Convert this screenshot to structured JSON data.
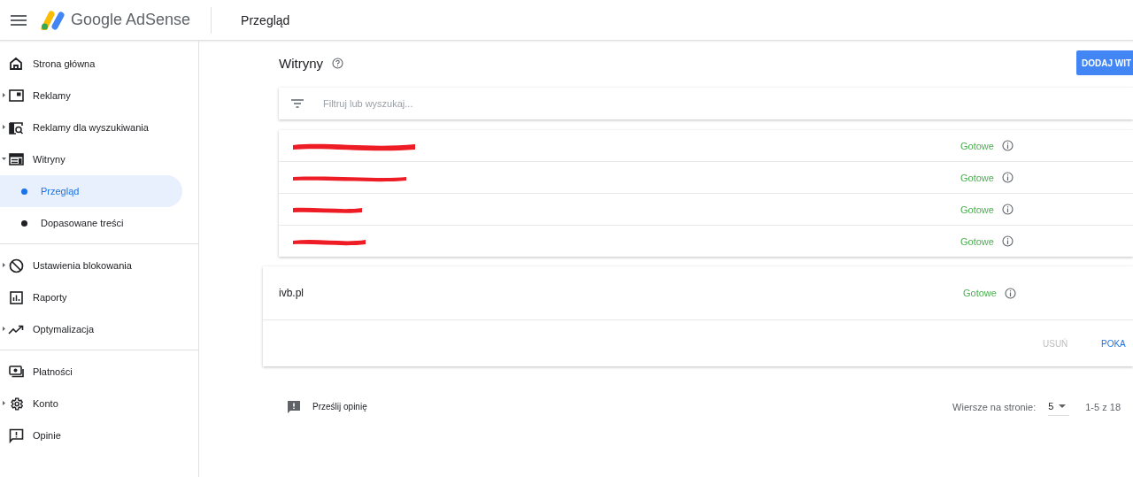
{
  "header": {
    "logo_text": "Google AdSense",
    "page_title": "Przegląd"
  },
  "sidebar": {
    "sections": [
      {
        "items": [
          {
            "label": "Strona główna",
            "kind": "link",
            "selected": false
          },
          {
            "label": "Reklamy",
            "kind": "group",
            "expanded": false,
            "selected": false
          },
          {
            "label": "Reklamy dla wyszukiwania",
            "kind": "group",
            "expanded": false,
            "selected": false
          },
          {
            "label": "Witryny",
            "kind": "group",
            "expanded": true,
            "selected": false
          },
          {
            "label": "Przegląd",
            "kind": "subitem",
            "selected": true
          },
          {
            "label": "Dopasowane treści",
            "kind": "subitem",
            "selected": false
          }
        ]
      },
      {
        "items": [
          {
            "label": "Ustawienia blokowania",
            "kind": "group",
            "expanded": false,
            "selected": false
          },
          {
            "label": "Raporty",
            "kind": "link",
            "selected": false
          },
          {
            "label": "Optymalizacja",
            "kind": "group",
            "expanded": false,
            "selected": false
          }
        ]
      },
      {
        "items": [
          {
            "label": "Płatności",
            "kind": "link",
            "selected": false
          },
          {
            "label": "Konto",
            "kind": "group",
            "expanded": false,
            "selected": false
          },
          {
            "label": "Opinie",
            "kind": "link",
            "selected": false
          }
        ]
      }
    ]
  },
  "main": {
    "title": "Witryny",
    "add_button": "DODAJ WIT",
    "search": {
      "placeholder": "Filtruj lub wyszukaj..."
    },
    "sites": [
      {
        "redacted": true,
        "status": "Gotowe"
      },
      {
        "redacted": true,
        "status": "Gotowe"
      },
      {
        "redacted": true,
        "status": "Gotowe"
      },
      {
        "redacted": true,
        "status": "Gotowe"
      }
    ],
    "expanded_site": {
      "name": "ivb.pl",
      "status": "Gotowe",
      "actions": [
        {
          "label": "USUŃ",
          "disabled": true
        },
        {
          "label": "POKA",
          "disabled": false
        }
      ]
    },
    "footer": {
      "feedback": "Prześlij opinię",
      "rows_label": "Wiersze na stronie:",
      "rows_value": "5",
      "range": "1-5 z 18"
    }
  }
}
